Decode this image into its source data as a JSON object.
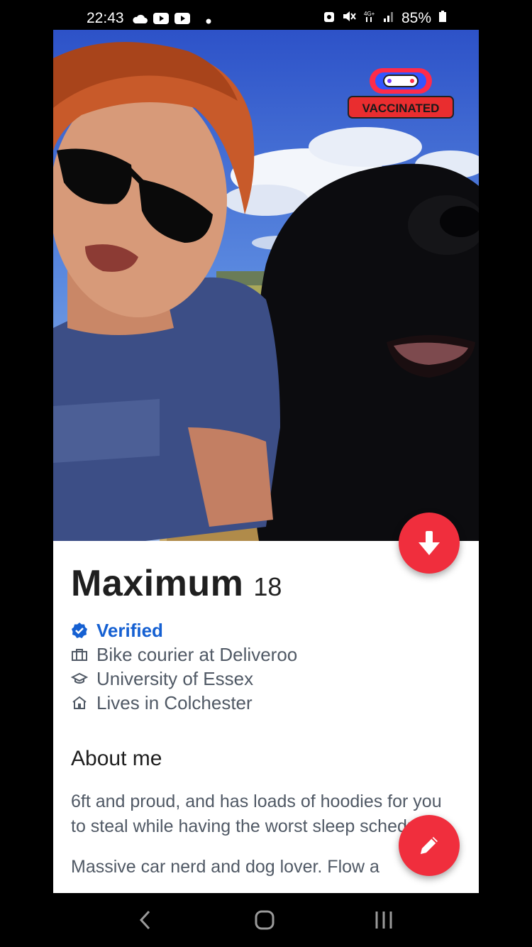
{
  "status_bar": {
    "time": "22:43",
    "battery": "85%",
    "left_icons": [
      "cloud-icon",
      "youtube-icon",
      "youtube-icon",
      "dot-icon"
    ],
    "right_icons": [
      "alarm-icon",
      "mute-icon",
      "network-4g-icon",
      "signal-icon",
      "battery-icon"
    ]
  },
  "profile": {
    "badge_text": "VACCINATED",
    "name": "Maximum",
    "age": "18",
    "verified_label": "Verified",
    "job": "Bike courier at Deliveroo",
    "school": "University of Essex",
    "location": "Lives in Colchester",
    "about_title": "About me",
    "about_text": "6ft and proud, and has loads of hoodies for you to steal while having the worst sleep schedule.",
    "about_more": "Massive car nerd and dog lover. Flow a"
  },
  "colors": {
    "accent": "#f02e3d",
    "verified": "#1560d2",
    "text_secondary": "#505965"
  },
  "nav_bar": {
    "items": [
      "back-icon",
      "home-icon",
      "recents-icon"
    ]
  }
}
